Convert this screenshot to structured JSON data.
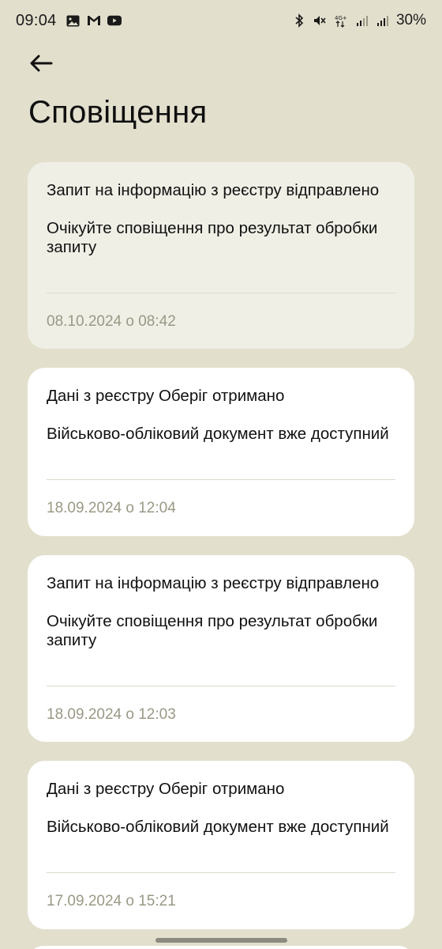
{
  "status_bar": {
    "time": "09:04",
    "battery": "30%",
    "network_label": "4G+"
  },
  "header": {
    "title": "Сповіщення"
  },
  "notifications": [
    {
      "title": "Запит на інформацію з реєстру відправлено",
      "body": "Очікуйте сповіщення про результат обробки запиту",
      "date": "08.10.2024 о 08:42",
      "unread": true
    },
    {
      "title": "Дані з реєстру Оберіг отримано",
      "body": "Військово-обліковий документ вже доступний",
      "date": "18.09.2024 о 12:04",
      "unread": false
    },
    {
      "title": "Запит на інформацію з реєстру відправлено",
      "body": "Очікуйте сповіщення про результат обробки запиту",
      "date": "18.09.2024 о 12:03",
      "unread": false
    },
    {
      "title": "Дані з реєстру Оберіг отримано",
      "body": "Військово-обліковий документ вже доступний",
      "date": "17.09.2024 о 15:21",
      "unread": false
    }
  ]
}
